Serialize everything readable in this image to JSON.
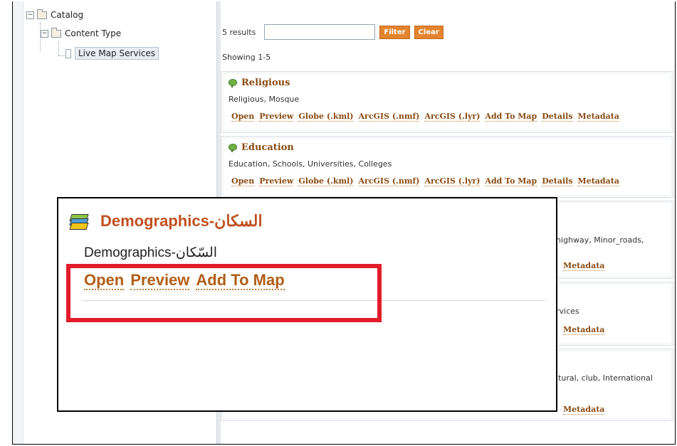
{
  "tree": {
    "root": {
      "label": "Catalog",
      "toggle": "−"
    },
    "child": {
      "label": "Content Type",
      "toggle": "−"
    },
    "leaf": {
      "label": "Live Map Services"
    }
  },
  "toolbar": {
    "results_label": "5 results",
    "filter_value": "",
    "filter_button": "Filter",
    "clear_button": "Clear"
  },
  "showing": "Showing 1-5",
  "links_labels": {
    "open": "Open",
    "preview": "Preview",
    "globe": "Globe (.kml)",
    "arcgis_nmf": "ArcGIS (.nmf)",
    "arcgis_lyr": "ArcGIS (.lyr)",
    "add_to_map": "Add To Map",
    "details": "Details",
    "metadata": "Metadata"
  },
  "cards": [
    {
      "title": "Religious",
      "desc": "Religious, Mosque"
    },
    {
      "title": "Education",
      "desc": "Education, Schools, Universities, Colleges"
    }
  ],
  "partial_cards": [
    {
      "tail": "highway, Minor_roads,",
      "metadata": "Metadata"
    },
    {
      "tail": "rvices",
      "metadata": "Metadata"
    },
    {
      "tail": "ltural, club, International",
      "metadata": "Metadata"
    }
  ],
  "popup": {
    "title": "Demographics-السكان",
    "subtitle": "Demographics-السّكان",
    "links": {
      "open": "Open",
      "preview": "Preview",
      "add_to_map": "Add To Map"
    }
  },
  "colors": {
    "link": "#8a4b12",
    "popup_title": "#c0501f",
    "highlight": "#e21c2a",
    "button": "#e3842e"
  }
}
